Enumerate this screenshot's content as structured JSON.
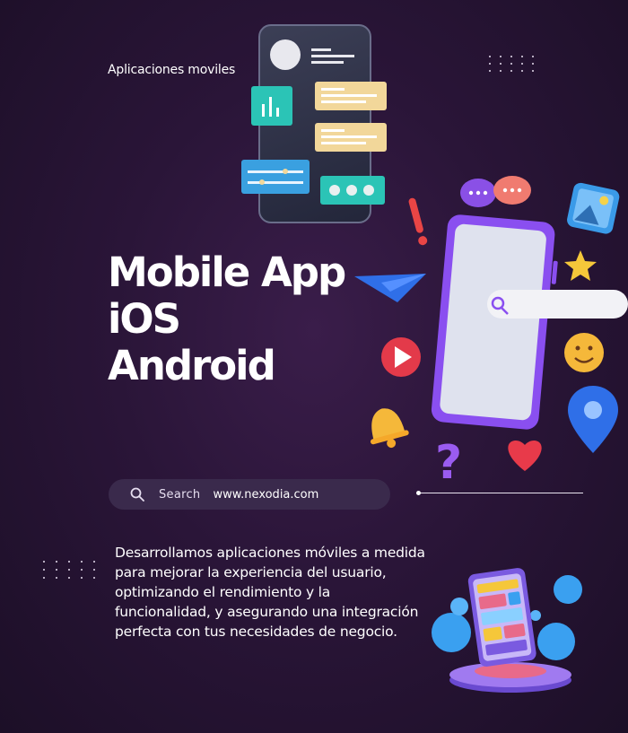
{
  "tag": "Aplicaciones moviles",
  "hero": {
    "line1": "Mobile App",
    "line2": "iOS",
    "line3": "Android"
  },
  "search": {
    "label": "Search",
    "url": "www.nexodia.com",
    "icon": "search-icon"
  },
  "description": "Desarrollamos aplicaciones móviles a medida para mejorar la experiencia del usuario, optimizando el rendimiento y la funcionalidad, y asegurando una integración perfecta con tus necesidades de negocio.",
  "colors": {
    "background": "#2a1538",
    "accent_purple": "#8a5cf6",
    "search_bg": "#3a2a4c"
  }
}
